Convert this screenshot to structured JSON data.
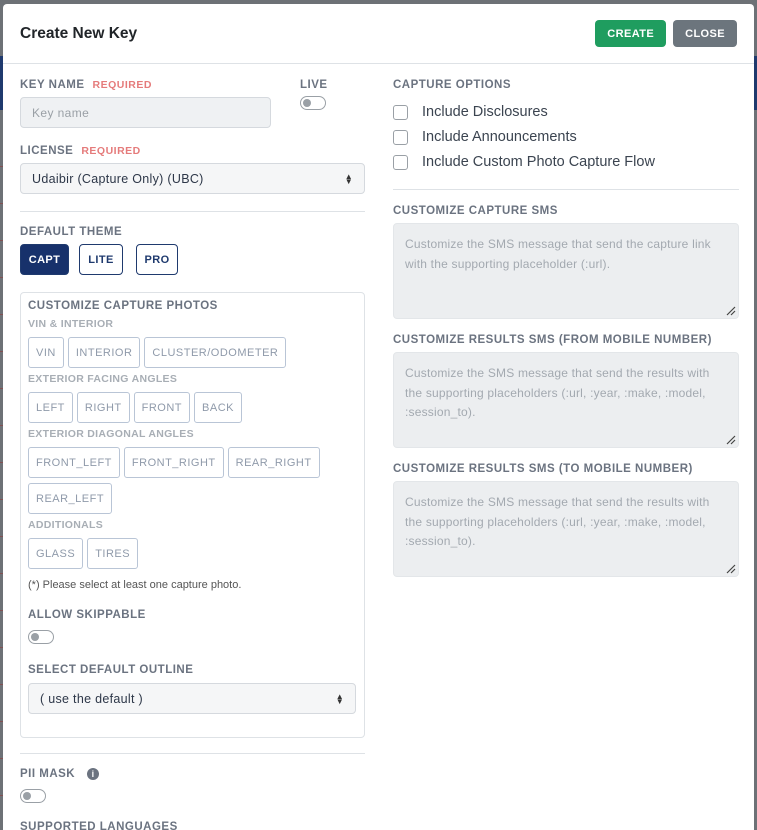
{
  "modal": {
    "title": "Create New Key",
    "create_label": "CREATE",
    "close_label": "CLOSE"
  },
  "key_name": {
    "label": "KEY NAME",
    "required": "REQUIRED",
    "placeholder": "Key name"
  },
  "live": {
    "label": "LIVE",
    "on": false
  },
  "license": {
    "label": "LICENSE",
    "required": "REQUIRED",
    "selected": "Udaibir (Capture Only) (UBC)"
  },
  "theme": {
    "label": "DEFAULT THEME",
    "options": [
      "CAPT",
      "LITE",
      "PRO"
    ],
    "selected": "CAPT",
    "active_color": "#17316b"
  },
  "photos": {
    "label": "CUSTOMIZE CAPTURE PHOTOS",
    "groups": [
      {
        "name": "VIN & INTERIOR",
        "items": [
          "VIN",
          "INTERIOR",
          "CLUSTER/ODOMETER"
        ]
      },
      {
        "name": "EXTERIOR FACING ANGLES",
        "items": [
          "LEFT",
          "RIGHT",
          "FRONT",
          "BACK"
        ]
      },
      {
        "name": "EXTERIOR DIAGONAL ANGLES",
        "items": [
          "FRONT_LEFT",
          "FRONT_RIGHT",
          "REAR_RIGHT",
          "REAR_LEFT"
        ]
      },
      {
        "name": "ADDITIONALS",
        "items": [
          "GLASS",
          "TIRES"
        ]
      }
    ],
    "note": "(*) Please select at least one capture photo.",
    "allow_skippable": "ALLOW SKIPPABLE",
    "outline_label": "SELECT DEFAULT OUTLINE",
    "outline_selected": "( use the default )"
  },
  "pii_mask": {
    "label": "PII MASK",
    "icon": "info-icon",
    "on": false
  },
  "supported_languages": "SUPPORTED LANGUAGES",
  "capture_options": {
    "label": "CAPTURE OPTIONS",
    "items": [
      "Include Disclosures",
      "Include Announcements",
      "Include Custom Photo Capture Flow"
    ]
  },
  "sms": [
    {
      "label": "CUSTOMIZE CAPTURE SMS",
      "placeholder": "Customize the SMS message that send the capture link with the supporting placeholder (:url)."
    },
    {
      "label": "CUSTOMIZE RESULTS SMS (FROM MOBILE NUMBER)",
      "placeholder": "Customize the SMS message that send the results with the supporting placeholders (:url, :year, :make, :model, :session_to)."
    },
    {
      "label": "CUSTOMIZE RESULTS SMS (TO MOBILE NUMBER)",
      "placeholder": "Customize the SMS message that send the results with the supporting placeholders (:url, :year, :make, :model, :session_to)."
    }
  ],
  "colors": {
    "create": "#1f9d5f",
    "close": "#6c757d"
  }
}
